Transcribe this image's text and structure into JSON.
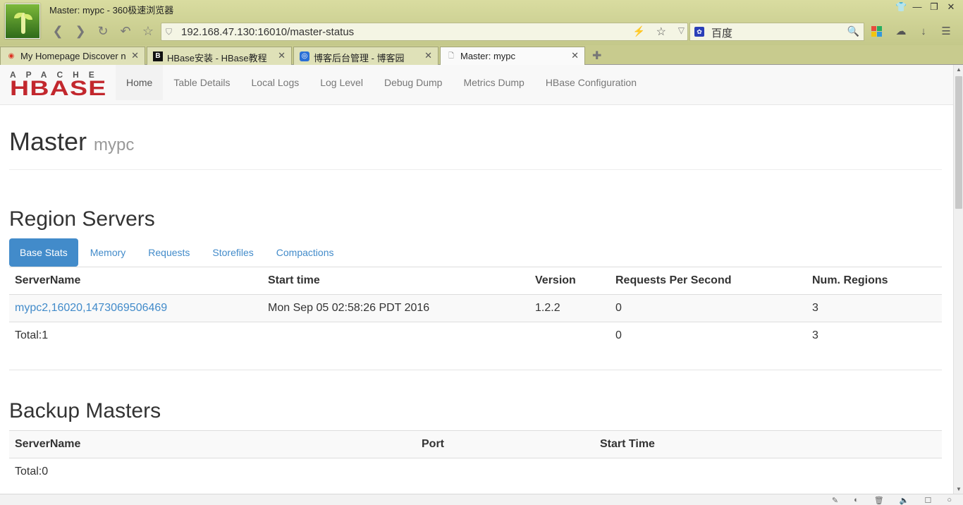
{
  "browser": {
    "window_title": "Master: mypc - 360极速浏览器",
    "url": "192.168.47.130:16010/master-status",
    "search_engine": "百度",
    "tabs": [
      {
        "label": "My Homepage Discover n",
        "favicon": "weibo-icon",
        "active": false
      },
      {
        "label": "HBase安装 - HBase教程",
        "favicon": "b-icon",
        "active": false
      },
      {
        "label": "博客后台管理 - 博客园",
        "favicon": "cnblogs-icon",
        "active": false
      },
      {
        "label": "Master: mypc",
        "favicon": "page-icon",
        "active": true
      }
    ]
  },
  "navbar": {
    "logo_top": "APACHE",
    "logo_main": "HBASE",
    "links": [
      "Home",
      "Table Details",
      "Local Logs",
      "Log Level",
      "Debug Dump",
      "Metrics Dump",
      "HBase Configuration"
    ]
  },
  "header": {
    "title": "Master",
    "subtitle": "mypc"
  },
  "region_servers": {
    "heading": "Region Servers",
    "tabs": [
      "Base Stats",
      "Memory",
      "Requests",
      "Storefiles",
      "Compactions"
    ],
    "columns": [
      "ServerName",
      "Start time",
      "Version",
      "Requests Per Second",
      "Num. Regions"
    ],
    "rows": [
      {
        "server": "mypc2,16020,1473069506469",
        "start": "Mon Sep 05 02:58:26 PDT 2016",
        "version": "1.2.2",
        "rps": "0",
        "regions": "3"
      }
    ],
    "total": {
      "label": "Total:1",
      "rps": "0",
      "regions": "3"
    }
  },
  "backup_masters": {
    "heading": "Backup Masters",
    "columns": [
      "ServerName",
      "Port",
      "Start Time"
    ],
    "total": "Total:0"
  },
  "colors": {
    "accent": "#428bca",
    "hbase_red": "#c2272d"
  }
}
